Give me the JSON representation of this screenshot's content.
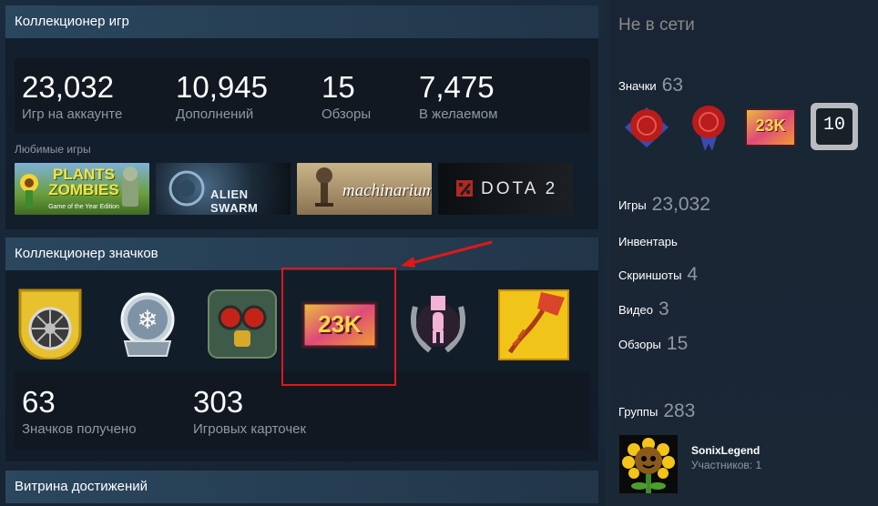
{
  "game_collector": {
    "title": "Коллекционер игр",
    "stats": [
      {
        "value": "23,032",
        "label": "Игр на аккаунте"
      },
      {
        "value": "10,945",
        "label": "Дополнений"
      },
      {
        "value": "15",
        "label": "Обзоры"
      },
      {
        "value": "7,475",
        "label": "В желаемом"
      }
    ],
    "favorites_label": "Любимые игры",
    "favorite_games": [
      {
        "name": "Plants vs. Zombies",
        "logo": "PLANTS ZOMBIES",
        "sub": "Game of the Year Edition"
      },
      {
        "name": "Alien Swarm",
        "logo": "ALIEN SWARM"
      },
      {
        "name": "Machinarium",
        "logo": "machinarium"
      },
      {
        "name": "Dota 2",
        "logo": "DOTA 2"
      }
    ]
  },
  "badge_collector": {
    "title": "Коллекционер значков",
    "badges": [
      {
        "icon": "wheel-badge-icon"
      },
      {
        "icon": "snow-globe-badge-icon"
      },
      {
        "icon": "gas-mask-badge-icon"
      },
      {
        "icon": "23k-badge-icon",
        "text": "23K"
      },
      {
        "icon": "pink-figure-laurel-badge-icon"
      },
      {
        "icon": "kite-badge-icon"
      }
    ],
    "stats": [
      {
        "value": "63",
        "label": "Значков получено"
      },
      {
        "value": "303",
        "label": "Игровых карточек"
      }
    ]
  },
  "showcase": {
    "title": "Витрина достижений"
  },
  "sidebar": {
    "status": "Не в сети",
    "badges_label": "Значки",
    "badges_count": "63",
    "badge_icons": [
      {
        "icon": "red-seal-blue-badge-icon"
      },
      {
        "icon": "red-seal-ribbon-badge-icon"
      },
      {
        "icon": "23k-badge-icon",
        "text": "23K"
      },
      {
        "icon": "years-service-badge-icon",
        "text": "10"
      }
    ],
    "games_label": "Игры",
    "games_count": "23,032",
    "inventory_label": "Инвентарь",
    "screenshots_label": "Скриншоты",
    "screenshots_count": "4",
    "videos_label": "Видео",
    "videos_count": "3",
    "reviews_label": "Обзоры",
    "reviews_count": "15",
    "groups_label": "Группы",
    "groups_count": "283",
    "group": {
      "name": "SonixLegend",
      "members": "Участников: 1"
    }
  },
  "colors": {
    "accent_red": "#e01818",
    "header": "#2a475e",
    "muted_text": "#8f98a0"
  }
}
